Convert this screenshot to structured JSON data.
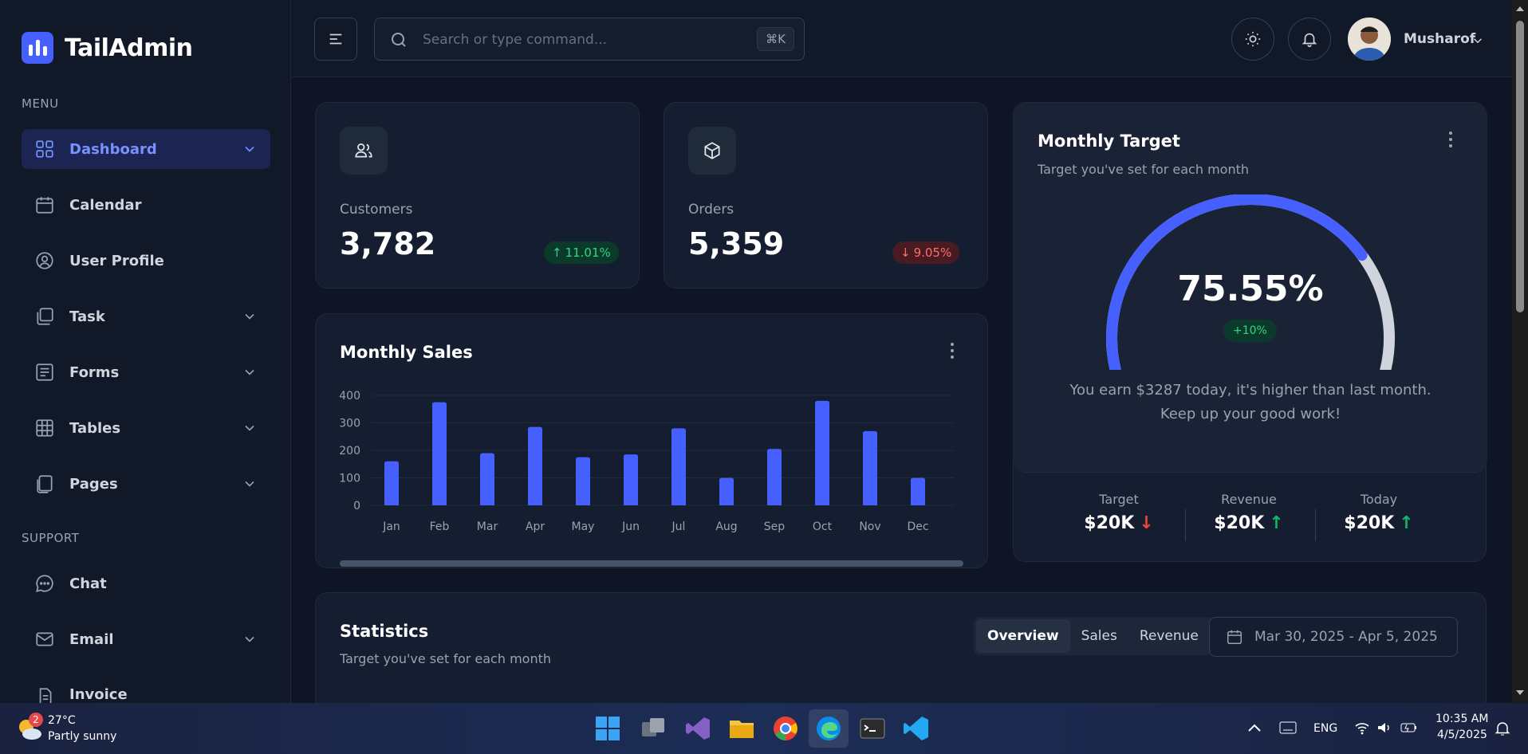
{
  "brand": {
    "name": "TailAdmin",
    "accent": "#465fff"
  },
  "sidebar": {
    "menu_label": "MENU",
    "support_label": "SUPPORT",
    "items": [
      {
        "label": "Dashboard",
        "icon": "grid-icon"
      },
      {
        "label": "Calendar",
        "icon": "calendar-icon"
      },
      {
        "label": "User Profile",
        "icon": "user-circle-icon"
      },
      {
        "label": "Task",
        "icon": "task-icon"
      },
      {
        "label": "Forms",
        "icon": "form-icon"
      },
      {
        "label": "Tables",
        "icon": "table-icon"
      },
      {
        "label": "Pages",
        "icon": "pages-icon"
      }
    ],
    "support_items": [
      {
        "label": "Chat",
        "icon": "chat-icon"
      },
      {
        "label": "Email",
        "icon": "mail-icon"
      },
      {
        "label": "Invoice",
        "icon": "invoice-icon"
      }
    ]
  },
  "header": {
    "search_placeholder": "Search or type command...",
    "shortcut": "⌘K",
    "user_name": "Musharof"
  },
  "metrics": [
    {
      "label": "Customers",
      "value": "3,782",
      "change": "11.01%",
      "direction": "up"
    },
    {
      "label": "Orders",
      "value": "5,359",
      "change": "9.05%",
      "direction": "down"
    }
  ],
  "monthly_sales": {
    "title": "Monthly Sales"
  },
  "chart_data": {
    "type": "bar",
    "title": "Monthly Sales",
    "categories": [
      "Jan",
      "Feb",
      "Mar",
      "Apr",
      "May",
      "Jun",
      "Jul",
      "Aug",
      "Sep",
      "Oct",
      "Nov",
      "Dec"
    ],
    "values": [
      160,
      375,
      190,
      285,
      175,
      185,
      280,
      100,
      205,
      380,
      270,
      100
    ],
    "yticks": [
      "0",
      "100",
      "200",
      "300",
      "400"
    ],
    "ylim": [
      0,
      400
    ],
    "color": "#465fff",
    "grid": true
  },
  "monthly_target": {
    "title": "Monthly Target",
    "subtitle": "Target you've set for each month",
    "percent": "75.55%",
    "percent_value": 75.55,
    "badge": "+10%",
    "message_line1": "You earn $3287 today, it's higher than last month.",
    "message_line2": "Keep up your good work!",
    "kpis": [
      {
        "label": "Target",
        "value": "$20K",
        "direction": "down"
      },
      {
        "label": "Revenue",
        "value": "$20K",
        "direction": "up"
      },
      {
        "label": "Today",
        "value": "$20K",
        "direction": "up"
      }
    ]
  },
  "statistics": {
    "title": "Statistics",
    "subtitle": "Target you've set for each month",
    "tabs": [
      "Overview",
      "Sales",
      "Revenue"
    ],
    "date_range": "Mar 30, 2025 - Apr 5, 2025"
  },
  "taskbar": {
    "weather_temp": "27°C",
    "weather_desc": "Partly sunny",
    "weather_badge": "2",
    "lang": "ENG",
    "time": "10:35 AM",
    "date": "4/5/2025"
  }
}
